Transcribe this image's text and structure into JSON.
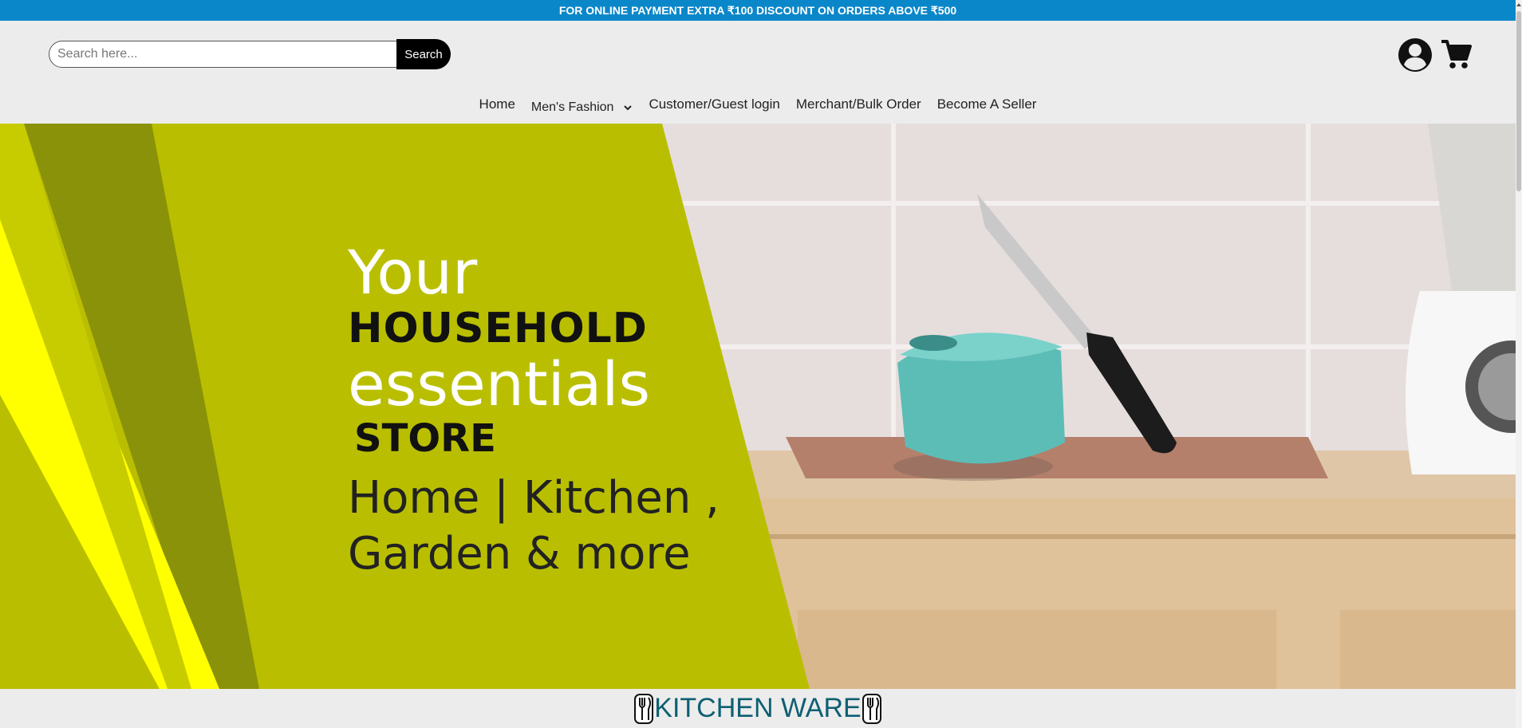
{
  "promo": {
    "text": "FOR ONLINE PAYMENT EXTRA ₹100 DISCOUNT ON ORDERS ABOVE ₹500"
  },
  "search": {
    "placeholder": "Search here...",
    "button_label": "Search"
  },
  "header": {
    "account_icon": "user-circle-icon",
    "cart_icon": "shopping-cart-icon"
  },
  "nav": {
    "home": "Home",
    "mens_fashion": "Men's Fashion",
    "customer_login": "Customer/Guest login",
    "merchant": "Merchant/Bulk Order",
    "seller": "Become A Seller"
  },
  "hero": {
    "line1": "Your",
    "line2": "HOUSEHOLD",
    "line3": "essentials",
    "line4": "STORE",
    "line5": "Home | Kitchen ,",
    "line6": "Garden & more"
  },
  "section": {
    "title": "KITCHEN WARE",
    "icon": "utensils-icon"
  },
  "colors": {
    "promo_bg": "#0a87c9",
    "hero_green": "#b9bf00",
    "section_title": "#0d5f73"
  }
}
